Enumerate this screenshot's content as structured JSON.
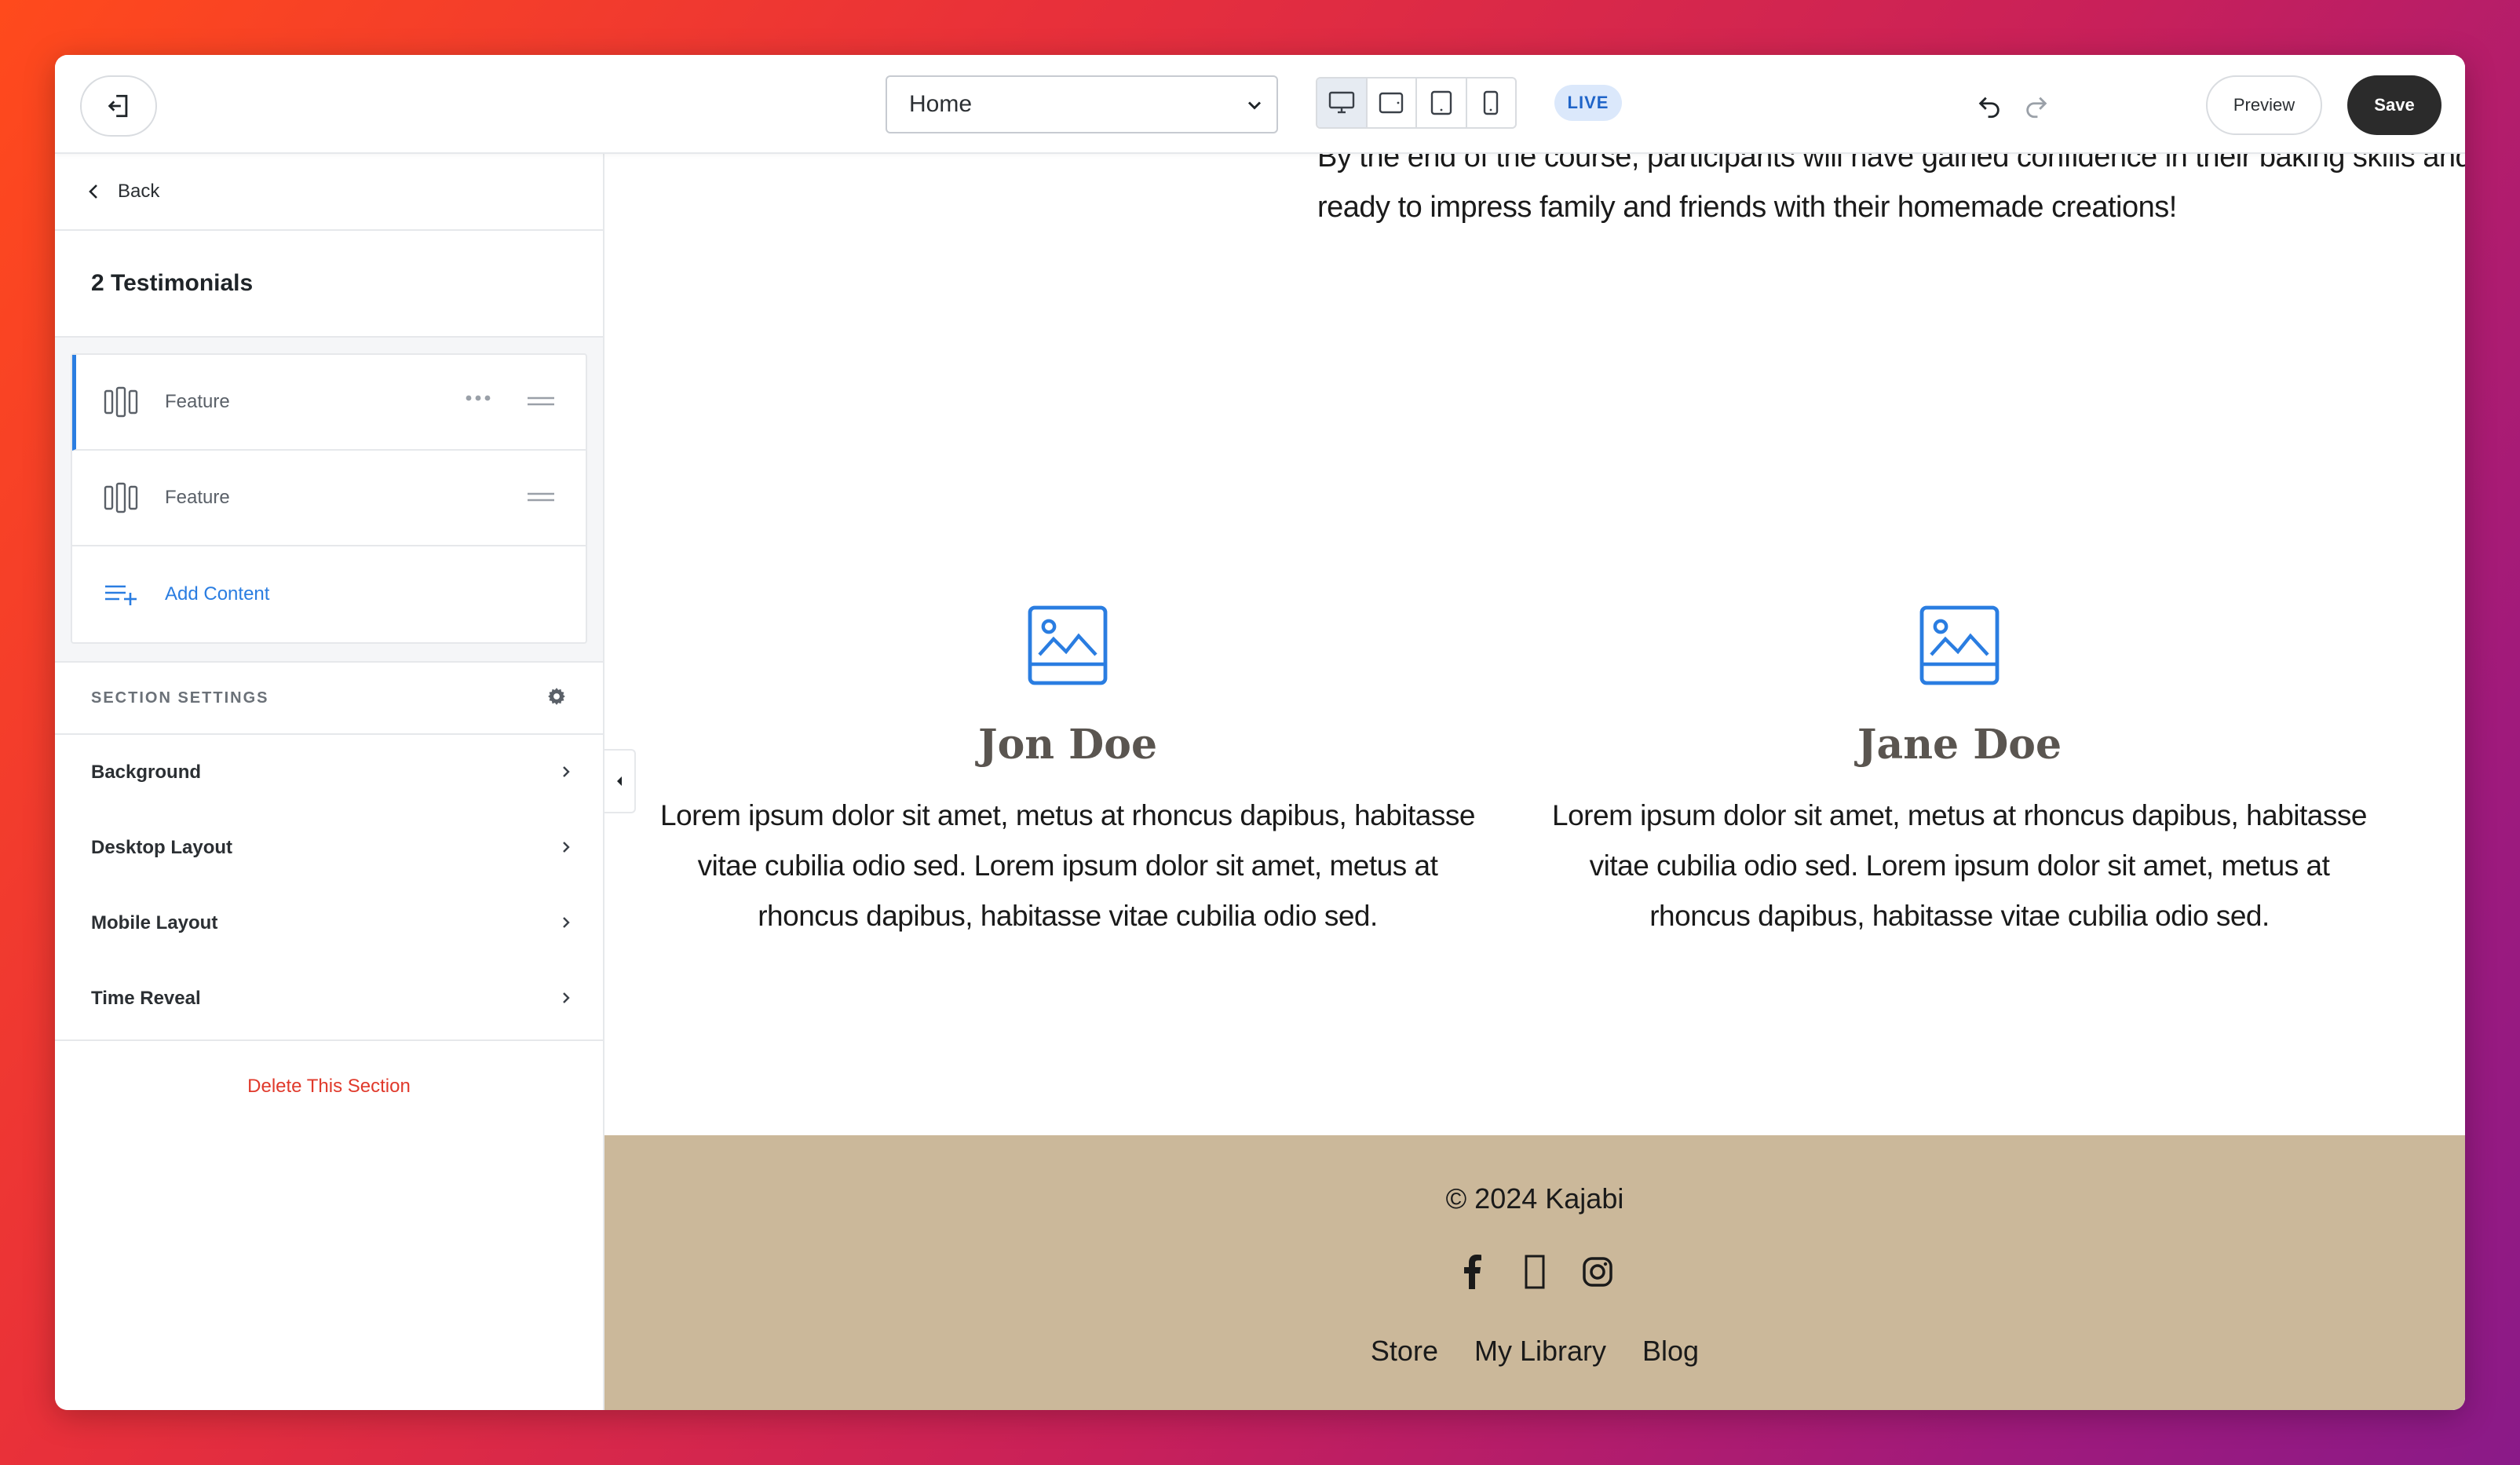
{
  "topbar": {
    "page_select_value": "Home",
    "live_badge": "LIVE",
    "preview_label": "Preview",
    "save_label": "Save",
    "devices": [
      "desktop-icon",
      "tablet-landscape-icon",
      "tablet-portrait-icon",
      "mobile-icon"
    ]
  },
  "sidebar": {
    "back_label": "Back",
    "section_title": "2 Testimonials",
    "blocks": [
      {
        "label": "Feature"
      },
      {
        "label": "Feature"
      }
    ],
    "add_content_label": "Add Content",
    "settings_heading": "SECTION SETTINGS",
    "settings_items": [
      {
        "label": "Background"
      },
      {
        "label": "Desktop Layout"
      },
      {
        "label": "Mobile Layout"
      },
      {
        "label": "Time Reveal"
      }
    ],
    "delete_label": "Delete This Section"
  },
  "canvas": {
    "intro_text": "By the end of the course, participants will have gained confidence in their baking skills and be ready to impress family and friends with their homemade creations!",
    "testimonials": [
      {
        "name": "Jon Doe",
        "quote": "Lorem ipsum dolor sit amet, metus at rhoncus dapibus, habitasse vitae cubilia odio sed. Lorem ipsum dolor sit amet, metus at rhoncus dapibus, habitasse vitae cubilia odio sed."
      },
      {
        "name": "Jane Doe",
        "quote": "Lorem ipsum dolor sit amet, metus at rhoncus dapibus, habitasse vitae cubilia odio sed. Lorem ipsum dolor sit amet, metus at rhoncus dapibus, habitasse vitae cubilia odio sed."
      }
    ],
    "footer": {
      "copyright": "© 2024 Kajabi",
      "socials": [
        "facebook-icon",
        "tiktok-icon",
        "instagram-icon"
      ],
      "links": [
        "Store",
        "My Library",
        "Blog"
      ]
    }
  },
  "colors": {
    "accent": "#2a7de1",
    "danger": "#e0392b",
    "footer_bg": "#cbb89a",
    "save_bg": "#2b2b2b"
  }
}
